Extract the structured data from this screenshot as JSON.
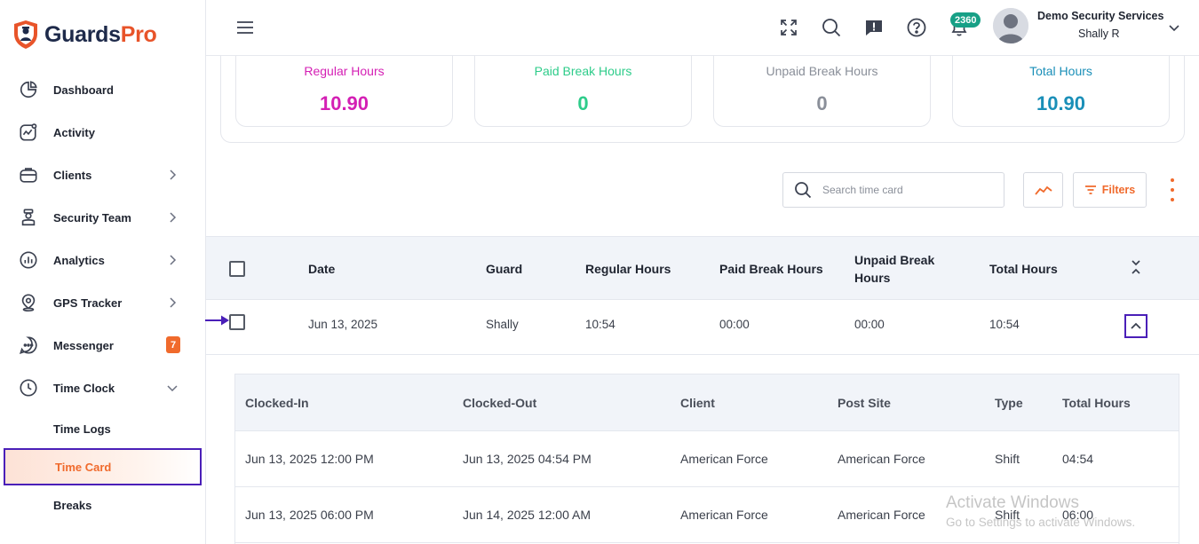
{
  "brand": {
    "name_part1": "Guards",
    "name_part2": "Pro",
    "primary_color": "#1e2a4a",
    "accent_color": "#f06a2c"
  },
  "sidebar": {
    "items": [
      {
        "label": "Dashboard",
        "icon": "pie-chart-icon"
      },
      {
        "label": "Activity",
        "icon": "activity-icon"
      },
      {
        "label": "Clients",
        "icon": "briefcase-icon",
        "has_children": true
      },
      {
        "label": "Security Team",
        "icon": "guard-icon",
        "has_children": true
      },
      {
        "label": "Analytics",
        "icon": "analytics-icon",
        "has_children": true
      },
      {
        "label": "GPS Tracker",
        "icon": "map-pin-icon",
        "has_children": true
      },
      {
        "label": "Messenger",
        "icon": "chat-icon",
        "badge": "7"
      },
      {
        "label": "Time Clock",
        "icon": "clock-icon",
        "expanded": true
      }
    ],
    "subitems": [
      {
        "label": "Time Logs"
      },
      {
        "label": "Time Card",
        "active": true
      },
      {
        "label": "Breaks"
      }
    ]
  },
  "header": {
    "notification_count": "2360",
    "user_company": "Demo Security Services",
    "user_name": "Shally R"
  },
  "summary": {
    "cards": [
      {
        "label": "Regular Hours",
        "value": "10.90",
        "color": "#d41fb4"
      },
      {
        "label": "Paid Break Hours",
        "value": "0",
        "color": "#2ecc8a"
      },
      {
        "label": "Unpaid Break Hours",
        "value": "0",
        "color": "#8a8f99"
      },
      {
        "label": "Total Hours",
        "value": "10.90",
        "color": "#1a8fb8"
      }
    ]
  },
  "toolbar": {
    "search_placeholder": "Search time card",
    "filters_label": "Filters"
  },
  "table": {
    "columns": {
      "date": "Date",
      "guard": "Guard",
      "regular": "Regular Hours",
      "paid": "Paid Break Hours",
      "unpaid_line1": "Unpaid Break",
      "unpaid_line2": "Hours",
      "total": "Total Hours"
    },
    "row": {
      "date": "Jun 13, 2025",
      "guard": "Shally",
      "regular": "10:54",
      "paid": "00:00",
      "unpaid": "00:00",
      "total": "10:54"
    }
  },
  "subtable": {
    "columns": {
      "clocked_in": "Clocked-In",
      "clocked_out": "Clocked-Out",
      "client": "Client",
      "post_site": "Post Site",
      "type": "Type",
      "total": "Total Hours"
    },
    "rows": [
      {
        "clocked_in": "Jun 13, 2025 12:00 PM",
        "clocked_out": "Jun 13, 2025 04:54 PM",
        "client": "American Force",
        "post_site": "American Force",
        "type": "Shift",
        "total": "04:54"
      },
      {
        "clocked_in": "Jun 13, 2025 06:00 PM",
        "clocked_out": "Jun 14, 2025 12:00 AM",
        "client": "American Force",
        "post_site": "American Force",
        "type": "Shift",
        "total": "06:00"
      }
    ]
  },
  "watermark": {
    "line1": "Activate Windows",
    "line2": "Go to Settings to activate Windows."
  }
}
